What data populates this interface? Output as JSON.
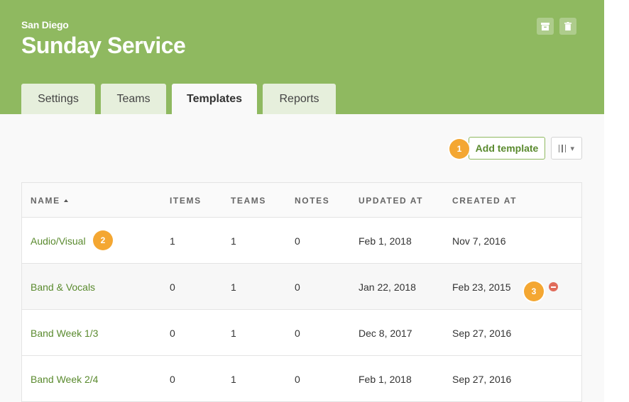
{
  "header": {
    "org_name": "San Diego",
    "title": "Sunday Service",
    "background_color": "#8fb960",
    "actions": [
      {
        "icon": "archive-icon"
      },
      {
        "icon": "trash-icon"
      }
    ]
  },
  "tabs": [
    {
      "label": "Settings",
      "active": false
    },
    {
      "label": "Teams",
      "active": false
    },
    {
      "label": "Templates",
      "active": true
    },
    {
      "label": "Reports",
      "active": false
    }
  ],
  "toolbar": {
    "add_template_label": "Add template",
    "columns_icon": "columns-icon",
    "dropdown_icon": "caret-down-icon",
    "accent_color": "#5a8a2e"
  },
  "callouts": [
    "1",
    "2",
    "3"
  ],
  "callout_color": "#f4a732",
  "table": {
    "columns": [
      "NAME",
      "ITEMS",
      "TEAMS",
      "NOTES",
      "UPDATED AT",
      "CREATED AT"
    ],
    "sort_column": "NAME",
    "sort_direction": "ascending",
    "rows": [
      {
        "name": "Audio/Visual",
        "items": "1",
        "teams": "1",
        "notes": "0",
        "updated_at": "Feb 1, 2018",
        "created_at": "Nov 7, 2016"
      },
      {
        "name": "Band & Vocals",
        "items": "0",
        "teams": "1",
        "notes": "0",
        "updated_at": "Jan 22, 2018",
        "created_at": "Feb 23, 2015"
      },
      {
        "name": "Band Week 1/3",
        "items": "0",
        "teams": "1",
        "notes": "0",
        "updated_at": "Dec 8, 2017",
        "created_at": "Sep 27, 2016"
      },
      {
        "name": "Band Week 2/4",
        "items": "0",
        "teams": "1",
        "notes": "0",
        "updated_at": "Feb 1, 2018",
        "created_at": "Sep 27, 2016"
      }
    ],
    "remove_icon": "remove-icon",
    "remove_color": "#e06b5a"
  }
}
